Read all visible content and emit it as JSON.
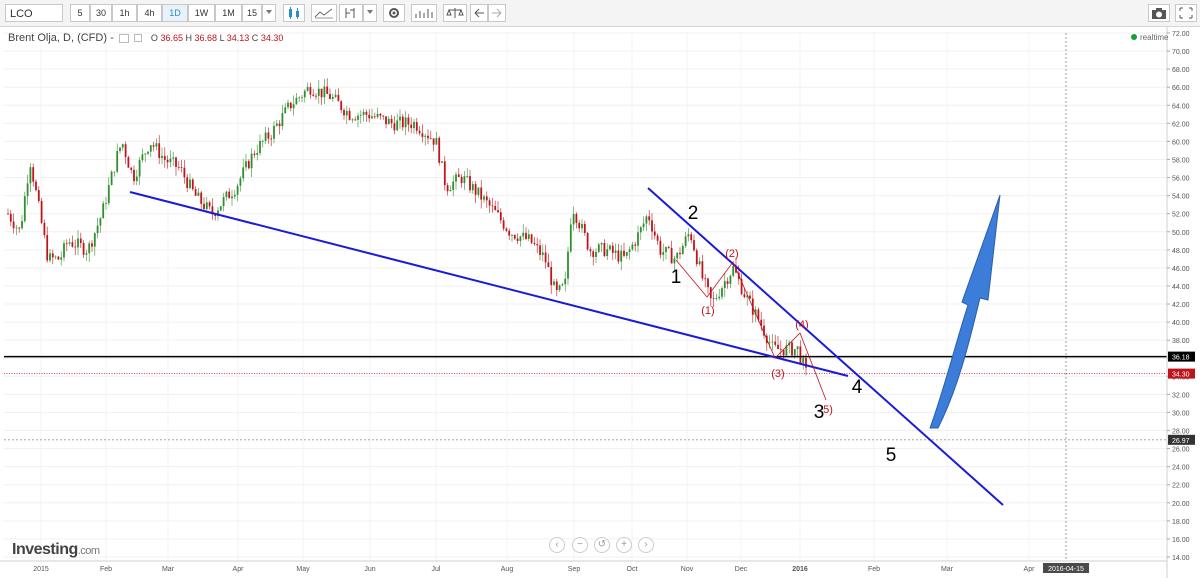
{
  "toolbar": {
    "symbol": "LCO",
    "intervals": [
      "5",
      "30",
      "1h",
      "4h",
      "1D",
      "1W",
      "1M",
      "15"
    ],
    "active_interval": "1D",
    "icons": [
      "candle-type-icon",
      "indicators-icon",
      "drawing-tools-icon",
      "settings-icon",
      "chart-type-icon",
      "compare-icon",
      "undo-icon",
      "redo-icon",
      "screenshot-icon",
      "fullscreen-icon"
    ]
  },
  "legend": {
    "instrument": "Brent Olja, D, (CFD) -",
    "o_label": "O",
    "o": "36.65",
    "h_label": "H",
    "h": "36.68",
    "l_label": "L",
    "l": "34.13",
    "c_label": "C",
    "c": "34.30"
  },
  "realtime": "realtime",
  "logo": {
    "main": "Investing",
    "suffix": ".com"
  },
  "colors": {
    "candle_up": "#2f8f2f",
    "candle_down": "#c0141c",
    "trendline": "#1a1adb",
    "wave_arrow": "#3b7dd8",
    "price_label_black": "#000000",
    "price_label_red": "#c0141c"
  },
  "chart_data": {
    "type": "candlestick",
    "ylim": [
      14,
      72
    ],
    "y_ticks": [
      "72.00",
      "70.00",
      "68.00",
      "66.00",
      "64.00",
      "62.00",
      "60.00",
      "58.00",
      "56.00",
      "54.00",
      "52.00",
      "50.00",
      "48.00",
      "46.00",
      "44.00",
      "42.00",
      "40.00",
      "38.00",
      "36.00",
      "34.00",
      "32.00",
      "30.00",
      "28.00",
      "26.00",
      "24.00",
      "22.00",
      "20.00",
      "18.00",
      "16.00",
      "14.00"
    ],
    "x_ticks": [
      "2015",
      "Feb",
      "Mar",
      "Apr",
      "May",
      "Jun",
      "Jul",
      "Aug",
      "Sep",
      "Oct",
      "Nov",
      "Dec",
      "2016",
      "Feb",
      "Mar",
      "Apr"
    ],
    "crosshair_date": "2016-04-15",
    "price_labels": [
      {
        "value": 36.18,
        "text": "36.18",
        "color": "black",
        "line": "solid"
      },
      {
        "value": 34.3,
        "text": "34.30",
        "color": "red",
        "line": "dotted"
      },
      {
        "value": 26.97,
        "text": "26.97",
        "color": "dark",
        "line": "dashed"
      }
    ],
    "wave_labels_major": [
      "1",
      "2",
      "3",
      "4",
      "5"
    ],
    "wave_labels_minor": [
      "(1)",
      "(2)",
      "(3)",
      "(4)",
      "5)"
    ],
    "approx_closes_by_month": {
      "2015-Jan": 48,
      "2015-Feb": 61,
      "2015-Mar": 55,
      "2015-Apr": 64,
      "2015-May": 65,
      "2015-Jun": 63,
      "2015-Jul": 54,
      "2015-Aug": 47,
      "2015-Sep": 48,
      "2015-Oct": 49,
      "2015-Nov": 45,
      "2015-Dec": 37,
      "2016-Jan": 34.3
    }
  }
}
